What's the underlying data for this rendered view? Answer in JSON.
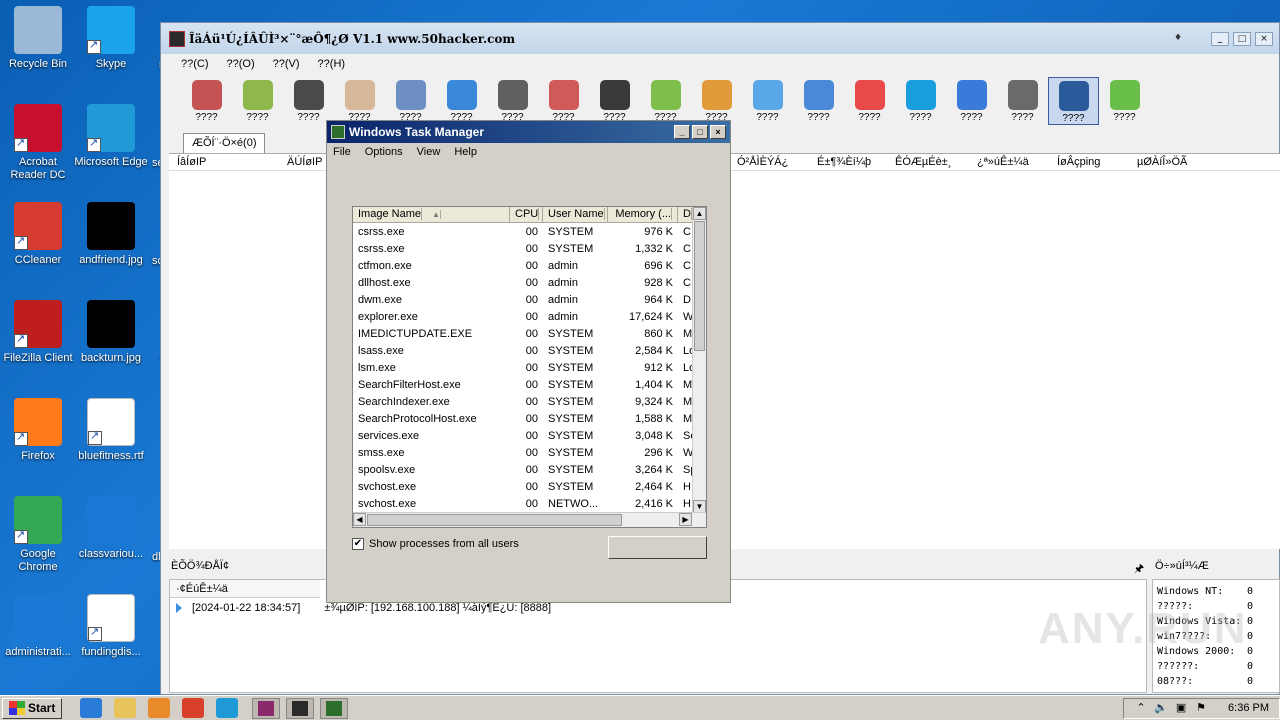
{
  "desktop": {
    "icons": [
      {
        "label": "Recycle Bin",
        "color": "#9bb8d8"
      },
      {
        "label": "Skype",
        "color": "#1aa3e8"
      },
      {
        "label": "Acrobat Reader DC",
        "color": "#c8102e"
      },
      {
        "label": "Microsoft Edge",
        "color": "#1f9ad6"
      },
      {
        "label": "CCleaner",
        "color": "#d63b2f"
      },
      {
        "label": "andfriend.jpg",
        "color": "#000000"
      },
      {
        "label": "FileZilla Client",
        "color": "#bf1e1e"
      },
      {
        "label": "backturn.jpg",
        "color": "#000000"
      },
      {
        "label": "Firefox",
        "color": "#ff7a1a"
      },
      {
        "label": "bluefitness.rtf",
        "color": "#ffffff"
      },
      {
        "label": "Google Chrome",
        "color": "#34a853"
      },
      {
        "label": "classvariou...",
        "color": "#1a79d4"
      },
      {
        "label": "administrati...",
        "color": "#1a79d4"
      },
      {
        "label": "fundingdis...",
        "color": "#ffffff"
      }
    ],
    "partial_labels": [
      "m",
      "se",
      "sc",
      "v",
      "dl"
    ]
  },
  "rat_window": {
    "title": "ÎäÁü¹Ú¿ÍÂÛÌ³×¨°æÔ¶¿Ø V1.1 www.50hacker.com",
    "menu": [
      "??(C)",
      "??(O)",
      "??(V)",
      "??(H)"
    ],
    "toolbar": [
      {
        "label": "????",
        "icon": "file-manager-icon",
        "color": "#c45454"
      },
      {
        "label": "????",
        "icon": "screen-icon",
        "color": "#8fb84a"
      },
      {
        "label": "????",
        "icon": "terminal-icon",
        "color": "#4a4a4a"
      },
      {
        "label": "????",
        "icon": "tools-icon",
        "color": "#d8b89a"
      },
      {
        "label": "????",
        "icon": "monitor-icon",
        "color": "#6d8fc4"
      },
      {
        "label": "????",
        "icon": "star-icon",
        "color": "#3a88d8"
      },
      {
        "label": "????",
        "icon": "webcam-icon",
        "color": "#606060"
      },
      {
        "label": "????",
        "icon": "microphone-icon",
        "color": "#d05a5a"
      },
      {
        "label": "????",
        "icon": "clock-icon",
        "color": "#3a3a3a"
      },
      {
        "label": "????",
        "icon": "download-icon",
        "color": "#7dbf4a"
      },
      {
        "label": "????",
        "icon": "favorite-icon",
        "color": "#e09a3a"
      },
      {
        "label": "????",
        "icon": "cloud-icon",
        "color": "#5aa8e8"
      },
      {
        "label": "????",
        "icon": "chat-icon",
        "color": "#4a88d8"
      },
      {
        "label": "????",
        "icon": "calendar-icon",
        "color": "#e84a4a"
      },
      {
        "label": "????",
        "icon": "skype-icon",
        "color": "#1a9ee0"
      },
      {
        "label": "????",
        "icon": "globe-icon",
        "color": "#3a7ad8"
      },
      {
        "label": "????",
        "icon": "gear-icon",
        "color": "#6a6a6a"
      },
      {
        "label": "????",
        "icon": "check-icon",
        "color": "#2a5a9a"
      },
      {
        "label": "????",
        "icon": "phone-icon",
        "color": "#6abf4a"
      }
    ],
    "tab_label": "ÆÕÍ¨·Ö×é(0)",
    "columns": [
      "ÍâÍøIP",
      "ÄÚÍøIP",
      "Ó²ÅÌÈÝÁ¿",
      "É±¶¾Èí¼þ",
      "ÊÓÆµÉè±¸",
      "¿ª»úÊ±¼ä",
      "ÍøÂçping",
      "µØÀíÎ»ÖÃ"
    ],
    "log_title": "ÈÕÖ¾ÐÅÏ¢",
    "log_header": "·¢ÉúÊ±¼ä",
    "log_entries": [
      {
        "time": "[2024-01-22 18:34:57]",
        "message": "±¾µØIP: [192.168.100.188] ¼àÌý¶Ë¿Ú: [8888]"
      }
    ],
    "pin": "🖈",
    "os_title": "Ö÷»úÍ³¼Æ",
    "os_stats": [
      {
        "label": "Windows NT:",
        "value": "0"
      },
      {
        "label": "?????:",
        "value": "0"
      },
      {
        "label": "Windows Vista:",
        "value": "0"
      },
      {
        "label": "win7????:",
        "value": "0"
      },
      {
        "label": "Windows 2000:",
        "value": "0"
      },
      {
        "label": "??????:",
        "value": "0"
      },
      {
        "label": "08???:",
        "value": "0"
      }
    ]
  },
  "task_manager": {
    "title": "Windows Task Manager",
    "menu": [
      "File",
      "Options",
      "View",
      "Help"
    ],
    "columns": [
      "Image Name",
      "CPU",
      "User Name",
      "Memory (...",
      "D"
    ],
    "processes": [
      {
        "name": "csrss.exe",
        "cpu": "00",
        "user": "SYSTEM",
        "mem": "976 K",
        "d": "C"
      },
      {
        "name": "csrss.exe",
        "cpu": "00",
        "user": "SYSTEM",
        "mem": "1,332 K",
        "d": "C"
      },
      {
        "name": "ctfmon.exe",
        "cpu": "00",
        "user": "admin",
        "mem": "696 K",
        "d": "C"
      },
      {
        "name": "dllhost.exe",
        "cpu": "00",
        "user": "admin",
        "mem": "928 K",
        "d": "C"
      },
      {
        "name": "dwm.exe",
        "cpu": "00",
        "user": "admin",
        "mem": "964 K",
        "d": "D"
      },
      {
        "name": "explorer.exe",
        "cpu": "00",
        "user": "admin",
        "mem": "17,624 K",
        "d": "W"
      },
      {
        "name": "IMEDICTUPDATE.EXE",
        "cpu": "00",
        "user": "SYSTEM",
        "mem": "860 K",
        "d": "M"
      },
      {
        "name": "lsass.exe",
        "cpu": "00",
        "user": "SYSTEM",
        "mem": "2,584 K",
        "d": "Lo"
      },
      {
        "name": "lsm.exe",
        "cpu": "00",
        "user": "SYSTEM",
        "mem": "912 K",
        "d": "Lo"
      },
      {
        "name": "SearchFilterHost.exe",
        "cpu": "00",
        "user": "SYSTEM",
        "mem": "1,404 K",
        "d": "M"
      },
      {
        "name": "SearchIndexer.exe",
        "cpu": "00",
        "user": "SYSTEM",
        "mem": "9,324 K",
        "d": "M"
      },
      {
        "name": "SearchProtocolHost.exe",
        "cpu": "00",
        "user": "SYSTEM",
        "mem": "1,588 K",
        "d": "M"
      },
      {
        "name": "services.exe",
        "cpu": "00",
        "user": "SYSTEM",
        "mem": "3,048 K",
        "d": "Se"
      },
      {
        "name": "smss.exe",
        "cpu": "00",
        "user": "SYSTEM",
        "mem": "296 K",
        "d": "W"
      },
      {
        "name": "spoolsv.exe",
        "cpu": "00",
        "user": "SYSTEM",
        "mem": "3,264 K",
        "d": "Sp"
      },
      {
        "name": "svchost.exe",
        "cpu": "00",
        "user": "SYSTEM",
        "mem": "2,464 K",
        "d": "H"
      },
      {
        "name": "svchost.exe",
        "cpu": "00",
        "user": "NETWO...",
        "mem": "2,416 K",
        "d": "H"
      }
    ],
    "show_all_label": "Show processes from all users",
    "show_all_checked": "✔"
  },
  "taskbar": {
    "start_label": "Start",
    "quick_launch": [
      {
        "icon": "ie-icon",
        "color": "#2a7ad8"
      },
      {
        "icon": "folder-icon",
        "color": "#e8c25a"
      },
      {
        "icon": "media-player-icon",
        "color": "#e88a2a"
      },
      {
        "icon": "chrome-icon",
        "color": "#d8402a"
      },
      {
        "icon": "edge-icon",
        "color": "#1f9ad6"
      }
    ],
    "tasks": [
      {
        "icon": "winrar-icon",
        "color": "#8a2a6a"
      },
      {
        "icon": "rat-app-icon",
        "color": "#2a2a2a"
      },
      {
        "icon": "task-manager-icon",
        "color": "#2c6e2c"
      }
    ],
    "clock": "6:36 PM"
  },
  "watermark": "ANY.RUN"
}
